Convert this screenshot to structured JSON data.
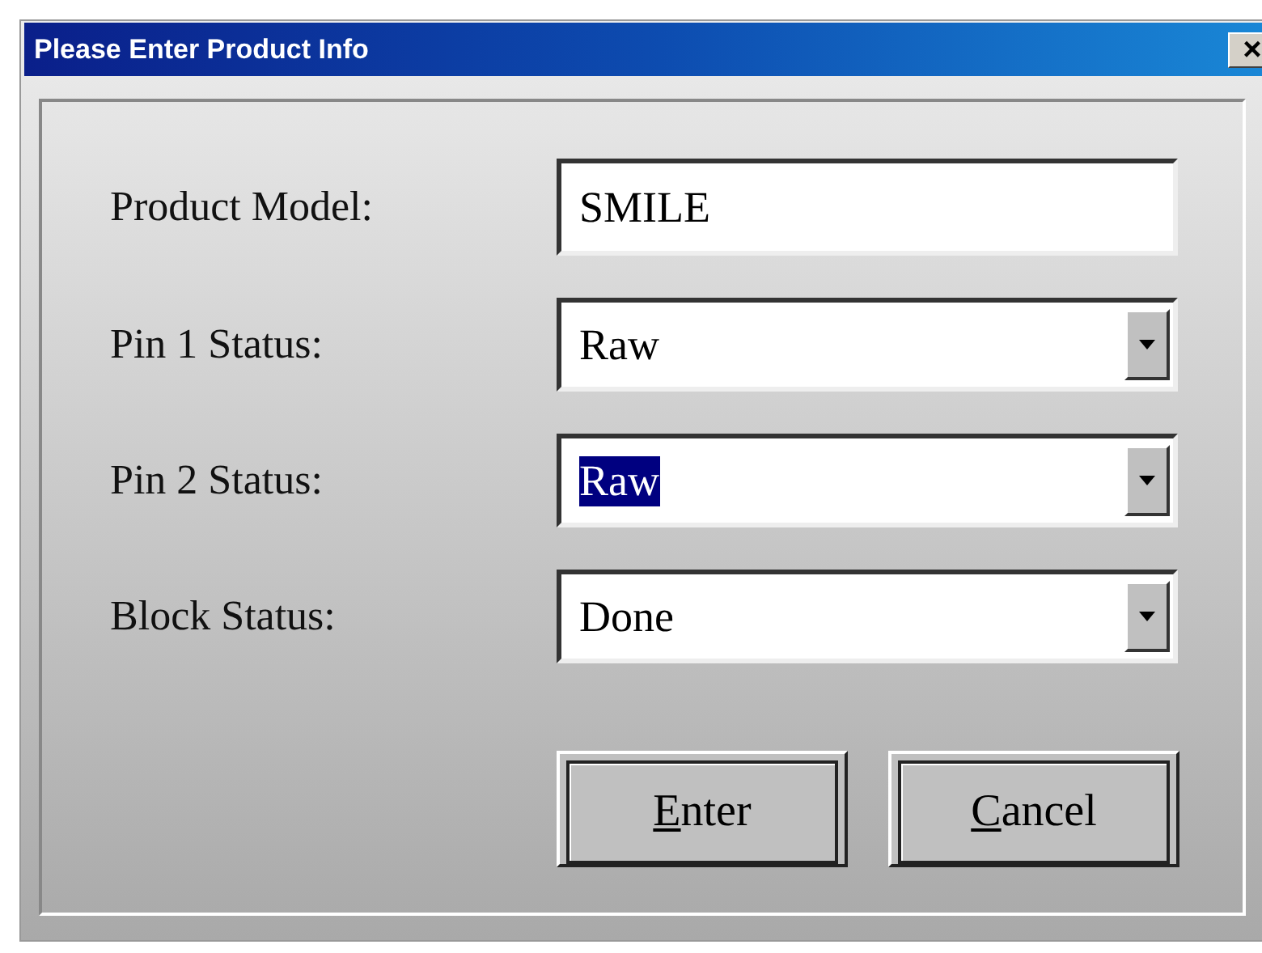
{
  "window": {
    "title": "Please Enter Product Info",
    "close": "×"
  },
  "fields": [
    {
      "label": "Product Model:",
      "kind": "text",
      "value": "SMILE",
      "text_selected": false
    },
    {
      "label": "Pin 1 Status:",
      "kind": "dropdown",
      "value": "Raw",
      "text_selected": false
    },
    {
      "label": "Pin 2 Status:",
      "kind": "dropdown",
      "value": "Raw",
      "text_selected": true
    },
    {
      "label": "Block Status:",
      "kind": "dropdown",
      "value": "Done",
      "text_selected": false
    }
  ],
  "buttons": [
    {
      "mnemonic_letter": "E",
      "label_rest": "nter"
    },
    {
      "mnemonic_letter": "C",
      "label_rest": "ancel"
    }
  ]
}
